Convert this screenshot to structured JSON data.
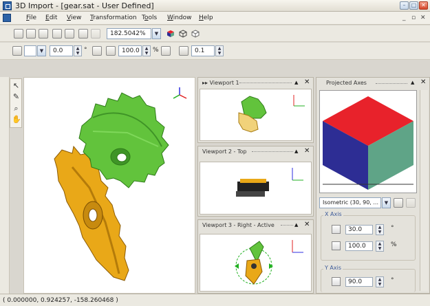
{
  "window": {
    "title": "3D Import - [gear.sat - User Defined]"
  },
  "menu": {
    "items": [
      {
        "pre": "",
        "u": "F",
        "post": "ile"
      },
      {
        "pre": "",
        "u": "E",
        "post": "dit"
      },
      {
        "pre": "",
        "u": "V",
        "post": "iew"
      },
      {
        "pre": "",
        "u": "T",
        "post": "ransformation"
      },
      {
        "pre": "T",
        "u": "o",
        "post": "ols"
      },
      {
        "pre": "",
        "u": "W",
        "post": "indow"
      },
      {
        "pre": "",
        "u": "H",
        "post": "elp"
      }
    ]
  },
  "toolbar1": {
    "zoom": "182.5042%"
  },
  "toolbar2": {
    "rotate_value": "0.0",
    "rotate_unit": "°",
    "scale_value": "100.0",
    "scale_unit": "%",
    "step_value": "0.1"
  },
  "viewports": [
    {
      "title": "Viewport 1"
    },
    {
      "title": "Viewport 2 - Top"
    },
    {
      "title": "Viewport 3 - Right - Active"
    }
  ],
  "projected_axes": {
    "title": "Projected Axes",
    "preset": "Isometric (30, 90, ...",
    "x_axis": {
      "label": "X Axis",
      "angle": "30.0",
      "angle_unit": "°",
      "scale": "100.0",
      "scale_unit": "%"
    },
    "y_axis": {
      "label": "Y Axis",
      "angle": "90.0",
      "angle_unit": "°"
    },
    "cube_colors": {
      "top": "#e8222b",
      "left": "#2d2d94",
      "right": "#5fa487"
    }
  },
  "status": {
    "coordinates": "( 0.000000, 0.924257, -158.260468 )"
  },
  "icons": [
    "app-icon",
    "minimize-icon",
    "maximize-icon",
    "close-icon",
    "select-arrow-icon",
    "pen-icon",
    "zoom-icon",
    "hand-pan-icon",
    "axis-gizmo-icon"
  ],
  "colors": {
    "gear_green": "#62c33c",
    "gear_gold": "#e9a818"
  }
}
